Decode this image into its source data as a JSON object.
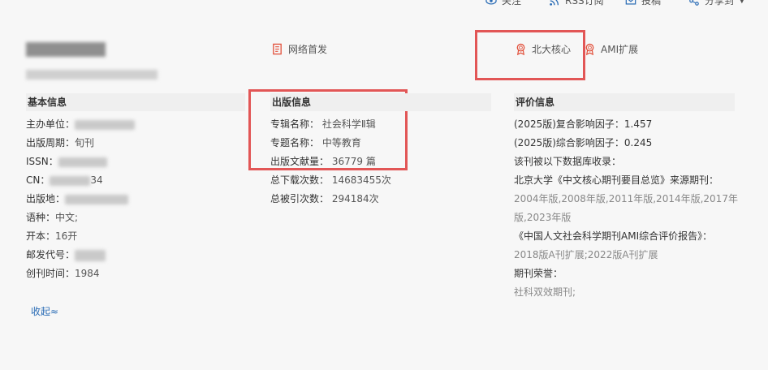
{
  "toolbar": {
    "follow": "关注",
    "rss": "RSS订阅",
    "submit": "投稿",
    "share": "分享到"
  },
  "tags": {
    "web_first": "网络首发",
    "pku_core": "北大核心",
    "ami": "AMI扩展"
  },
  "basic": {
    "title": "基本信息",
    "rows": [
      {
        "label": "主办单位：",
        "value": ""
      },
      {
        "label": "出版周期：",
        "value": "旬刊"
      },
      {
        "label": "ISSN：",
        "value": ""
      },
      {
        "label": "CN：",
        "value": "34"
      },
      {
        "label": "出版地：",
        "value": ""
      },
      {
        "label": "语种：",
        "value": "中文;"
      },
      {
        "label": "开本：",
        "value": "16开"
      },
      {
        "label": "邮发代号：",
        "value": ""
      },
      {
        "label": "创刊时间：",
        "value": "1984"
      }
    ]
  },
  "publish": {
    "title": "出版信息",
    "rows": [
      {
        "label": "专辑名称：",
        "value": "社会科学Ⅱ辑"
      },
      {
        "label": "专题名称：",
        "value": "中等教育"
      },
      {
        "label": "出版文献量：",
        "value": "36779 篇"
      },
      {
        "label": "总下载次数：",
        "value": "14683455次"
      },
      {
        "label": "总被引次数：",
        "value": "294184次"
      }
    ]
  },
  "eval": {
    "title": "评价信息",
    "rows": [
      "(2025版)复合影响因子：1.457",
      "(2025版)综合影响因子：0.245",
      "该刊被以下数据库收录：",
      "北京大学《中文核心期刊要目总览》来源期刊：",
      "2004年版,2008年版,2011年版,2014年版,2017年",
      "版,2023年版",
      "《中国人文社会科学期刊AMI综合评价报告》：",
      "2018版A刊扩展;2022版A刊扩展",
      "期刊荣誉：",
      "社科双效期刊;"
    ]
  },
  "collapse": "收起≈"
}
